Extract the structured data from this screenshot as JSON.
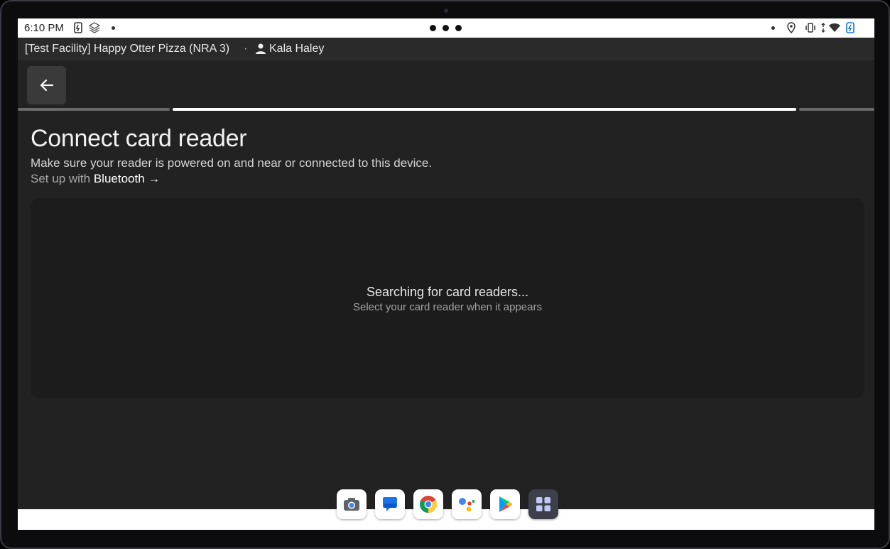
{
  "status_bar": {
    "time": "6:10 PM"
  },
  "facility_bar": {
    "facility": "[Test Facility] Happy Otter Pizza (NRA 3)",
    "separator": "·",
    "user": "Kala Haley"
  },
  "page": {
    "title": "Connect card reader",
    "subtitle": "Make sure your reader is powered on and near or connected to this device.",
    "bluetooth_prefix": "Set up with ",
    "bluetooth_link": "Bluetooth →"
  },
  "search": {
    "status": "Searching for card readers...",
    "hint": "Select your card reader when it appears"
  },
  "progress": {
    "steps_total": 3,
    "current_step": 2
  },
  "dock": {
    "apps": [
      "camera-icon",
      "messages-icon",
      "chrome-icon",
      "assistant-icon",
      "play-store-icon",
      "app-grid-icon"
    ]
  },
  "colors": {
    "background": "#222222",
    "card": "#1c1c1c",
    "accent": "#ffffff"
  }
}
